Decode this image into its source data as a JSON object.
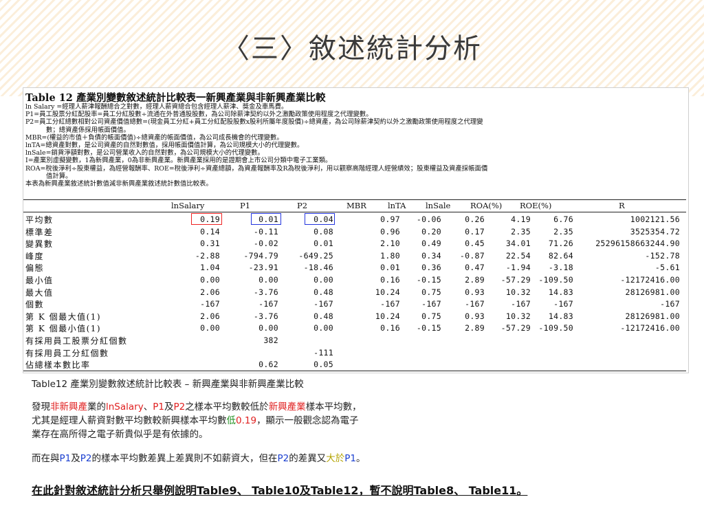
{
  "slide": {
    "title": "〈三〉敘述統計分析"
  },
  "scan": {
    "title": "Table 12 產業別變數敘述統計比較表一新興產業與非新興產業比較",
    "notes": [
      "ln Salary =經理人薪津報酬總合之對數，經理人薪資總合包含經理人薪津、獎金及車馬費。",
      "P1=員工股票分紅配股率=員工分紅股數÷流通在外普通股股數，為公司除薪津契約以外之激勵政策使用程度之代理變數。",
      "P2=員工分紅總數相對公司資產價值總數=(現金員工分紅+員工分紅配股股數x股利所屬年度股價)÷總資產，為公司除薪津契約以外之激勵政策使用程度之代理變",
      "數；總資產係採用帳面價值。",
      "MBR=(權益的市值＋負債的帳面價值)÷總資產的帳面價值，為公司成長機會的代理變數。",
      "lnTA=總資產對數，是公司資產的自然對數值，採用帳面價值計算，為公司規模大小的代理變數。",
      "lnSale=銷貨淨額對數，是公司營業收入的自然對數，為公司規模大小的代理變數。",
      "I=產業別虛擬變數，1為新興產業，0為非新興產業。新興產業採用的是證期會上市公司分類中電子工業類。",
      "ROA=稅後淨利÷股東權益，為經營報酬率、ROE=稅後淨利÷資產總額，為資產報酬率及R為稅後淨利，用以觀察高階經理人經營績效；股東權益及資產採帳面價",
      "值計算。",
      "本表為新興產業敘述統計數值減非新興產業敘述統計數值比較表。"
    ],
    "columns": [
      "lnSalary",
      "P1",
      "P2",
      "MBR",
      "lnTA",
      "lnSale",
      "ROA(%)",
      "ROE(%)",
      "R"
    ],
    "rows": [
      {
        "label": "平均數",
        "values": [
          "0.19",
          "0.01",
          "0.04",
          "0.97",
          "-0.06",
          "0.26",
          "4.19",
          "6.76",
          "1002121.56"
        ]
      },
      {
        "label": "標準差",
        "values": [
          "0.14",
          "-0.11",
          "0.08",
          "0.96",
          "0.20",
          "0.17",
          "2.35",
          "2.35",
          "3525354.72"
        ]
      },
      {
        "label": "變異數",
        "values": [
          "0.31",
          "-0.02",
          "0.01",
          "2.10",
          "0.49",
          "0.45",
          "34.01",
          "71.26",
          "25296158663244.90"
        ]
      },
      {
        "label": "峰度",
        "values": [
          "-2.88",
          "-794.79",
          "-649.25",
          "1.80",
          "0.34",
          "-0.87",
          "22.54",
          "82.64",
          "-152.78"
        ]
      },
      {
        "label": "偏態",
        "values": [
          "1.04",
          "-23.91",
          "-18.46",
          "0.01",
          "0.36",
          "0.47",
          "-1.94",
          "-3.18",
          "-5.61"
        ]
      },
      {
        "label": "最小值",
        "values": [
          "0.00",
          "0.00",
          "0.00",
          "0.16",
          "-0.15",
          "2.89",
          "-57.29",
          "-109.50",
          "-12172416.00"
        ]
      },
      {
        "label": "最大值",
        "values": [
          "2.06",
          "-3.76",
          "0.48",
          "10.24",
          "0.75",
          "0.93",
          "10.32",
          "14.83",
          "28126981.00"
        ]
      },
      {
        "label": "個數",
        "values": [
          "-167",
          "-167",
          "-167",
          "-167",
          "-167",
          "-167",
          "-167",
          "-167",
          "-167"
        ]
      },
      {
        "label": "第 K 個最大值(1)",
        "values": [
          "2.06",
          "-3.76",
          "0.48",
          "10.24",
          "0.75",
          "0.93",
          "10.32",
          "14.83",
          "28126981.00"
        ]
      },
      {
        "label": "第 K 個最小值(1)",
        "values": [
          "0.00",
          "0.00",
          "0.00",
          "0.16",
          "-0.15",
          "2.89",
          "-57.29",
          "-109.50",
          "-12172416.00"
        ]
      },
      {
        "label": "有採用員工股票分紅個數",
        "values": [
          "",
          "382",
          "",
          "",
          "",
          "",
          "",
          "",
          ""
        ]
      },
      {
        "label": "有採用員工分紅個數",
        "values": [
          "",
          "",
          "-111",
          "",
          "",
          "",
          "",
          "",
          ""
        ]
      },
      {
        "label": "佔總樣本數比率",
        "values": [
          "",
          "0.62",
          "0.05",
          "",
          "",
          "",
          "",
          "",
          ""
        ]
      }
    ],
    "highlight_colors": {
      "red": "#e22222",
      "blue": "#2233dd"
    }
  },
  "caption": "Table12 產業別變數敘述統計比較表 – 新興產業與非新興產業比較",
  "para1": {
    "l1_a": "發現",
    "l1_b": "非新興產",
    "l1_c": "業的",
    "l1_d": "lnSalary",
    "l1_e": "、",
    "l1_f": "P1",
    "l1_g": "及",
    "l1_h": "P2",
    "l1_i": "之樣本平均數較低於",
    "l1_j": "新興產業",
    "l1_k": "樣本平均數，",
    "l2_a": "尤其是經理人薪資對數平均數較新興樣本平均數",
    "l2_b": "低",
    "l2_c": "0.19",
    "l2_d": "，顯示一般觀念認為電子",
    "l3": "業存在高所得之電子新貴似乎是有依據的。"
  },
  "para2": {
    "a": "而在與",
    "b": "P1",
    "c": "及",
    "d": "P2",
    "e": "的樣本平均數差異上差異則不如薪資大，但在",
    "f": "P2",
    "g": "的差異又",
    "h": "大於",
    "i": "P1",
    "j": "。"
  },
  "bottom_note": "在此針對敘述統計分析只舉例說明Table9、 Table10及Table12，暫不說明Table8、 Table11。"
}
